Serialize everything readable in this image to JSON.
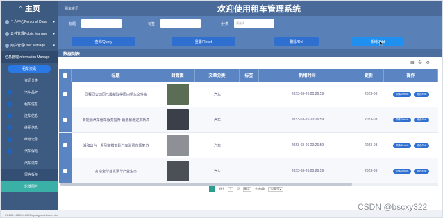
{
  "sidebar": {
    "logo": "主页",
    "groups": [
      {
        "label": "个人中心Personal Data"
      },
      {
        "label": "公共管理Public Manage"
      },
      {
        "label": "用户管理User Manage"
      },
      {
        "label": "信息管理Information Manage"
      }
    ],
    "active_button": "租车资讯",
    "subitems": [
      {
        "label": "资讯分类"
      },
      {
        "label": "汽车品牌"
      },
      {
        "label": "租车信息"
      },
      {
        "label": "还车信息"
      },
      {
        "label": "续租信息"
      },
      {
        "label": "维修记录"
      },
      {
        "label": "汽车保险"
      },
      {
        "label": "汽车违章"
      },
      {
        "label": "留言板块"
      },
      {
        "label": "轮播图片"
      }
    ]
  },
  "header": {
    "breadcrumb": "租车资讯",
    "title": "欢迎使用租车管理系统"
  },
  "search": {
    "title_label": "标题",
    "tag_label": "标签",
    "category_label": "分类",
    "category_placeholder": "请选择"
  },
  "buttons": {
    "query": "查询/Query",
    "reset": "重置/Reset",
    "delete": "删除/Del",
    "add": "新增/Add"
  },
  "list_title": "数据列表",
  "columns": {
    "title": "标题",
    "cover": "封面图",
    "category": "文章分类",
    "tag": "标签",
    "time": "新增时间",
    "more": "更新",
    "op": "操作"
  },
  "rows": [
    {
      "title": "同程同公司同已最新取得国内租车文件资",
      "category": "汽车",
      "time": "2023-03-26 20:26:59",
      "more": "2023-03",
      "cover_color": "#5b6e55",
      "detail": "详情/Details",
      "edit": "修改/Edit"
    },
    {
      "title": "新能源汽车租车服务提升 销量暴增迎来新高",
      "category": "汽车",
      "time": "2023-03-26 20:26:59",
      "more": "2023-03",
      "cover_color": "#3a3f4a",
      "detail": "详情/Details",
      "edit": "修改/Edit"
    },
    {
      "title": "潘和出台一系列举措鼓励汽车消费市场复苏",
      "category": "汽车",
      "time": "2023-03-26 20:26:59",
      "more": "2023-03",
      "cover_color": "#8d9196",
      "detail": "详情/Details",
      "edit": "修改/Edit"
    },
    {
      "title": "打造全球首发豪华产业生态",
      "category": "汽车",
      "time": "2023-03-26 20:26:59",
      "more": "2023-03",
      "cover_color": "#4b4f56",
      "detail": "详情/Details",
      "edit": "修改/Edit"
    }
  ],
  "pager": {
    "current": "1",
    "goto_label": "前往",
    "page": "1",
    "page_unit": "页",
    "confirm": "确定",
    "total": "共计4条",
    "size": "10条/页"
  },
  "status_url": "39.108.108.204:8090/springboot/index.html",
  "watermark": "CSDN @bscxy322"
}
